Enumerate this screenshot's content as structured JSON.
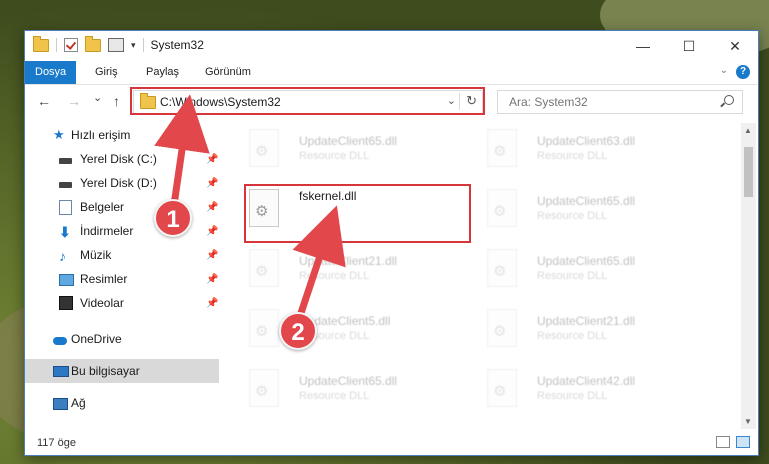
{
  "window": {
    "title": "System32",
    "buttons": {
      "minimize": "—",
      "maximize": "☐",
      "close": "✕"
    }
  },
  "ribbon": {
    "tabs": [
      "Dosya",
      "Giriş",
      "Paylaş",
      "Görünüm"
    ],
    "active_tab": "Dosya",
    "help": "?"
  },
  "nav": {
    "back": "←",
    "forward": "→",
    "recent": "⌄",
    "up": "↑",
    "address": "C:\\Windows\\System32",
    "refresh": "↻",
    "dropdown": "⌄",
    "search_placeholder": "Ara: System32"
  },
  "sidebar": {
    "items": [
      {
        "label": "Hızlı erişim",
        "icon": "star-icon"
      },
      {
        "label": "Yerel Disk (C:)",
        "icon": "drive-icon",
        "pinned": true
      },
      {
        "label": "Yerel Disk (D:)",
        "icon": "drive-icon",
        "pinned": true
      },
      {
        "label": "Belgeler",
        "icon": "documents-icon",
        "pinned": true
      },
      {
        "label": "İndirmeler",
        "icon": "downloads-icon",
        "pinned": true
      },
      {
        "label": "Müzik",
        "icon": "music-icon",
        "pinned": true
      },
      {
        "label": "Resimler",
        "icon": "pictures-icon",
        "pinned": true
      },
      {
        "label": "Videolar",
        "icon": "videos-icon",
        "pinned": true
      },
      {
        "label": "OneDrive",
        "icon": "cloud-icon"
      },
      {
        "label": "Bu bilgisayar",
        "icon": "computer-icon",
        "selected": true
      },
      {
        "label": "Ağ",
        "icon": "network-icon"
      }
    ],
    "pin_glyph": "📌"
  },
  "files": {
    "col1": [
      {
        "name": "UpdateClient65.dll",
        "type": "Resource DLL"
      },
      {
        "name": "fskernel.dll",
        "type": ""
      },
      {
        "name": "UpdateClient21.dll",
        "type": "Resource DLL"
      },
      {
        "name": "UpdateClient5.dll",
        "type": "Resource DLL"
      },
      {
        "name": "UpdateClient65.dll",
        "type": "Resource DLL"
      }
    ],
    "col2": [
      {
        "name": "UpdateClient63.dll",
        "type": "Resource DLL"
      },
      {
        "name": "UpdateClient65.dll",
        "type": "Resource DLL"
      },
      {
        "name": "UpdateClient65.dll",
        "type": "Resource DLL"
      },
      {
        "name": "UpdateClient21.dll",
        "type": "Resource DLL"
      },
      {
        "name": "UpdateClient42.dll",
        "type": "Resource DLL"
      }
    ]
  },
  "status": {
    "count": "117 öge"
  },
  "annotations": {
    "badge1": "1",
    "badge2": "2",
    "color": "#e2474c"
  }
}
